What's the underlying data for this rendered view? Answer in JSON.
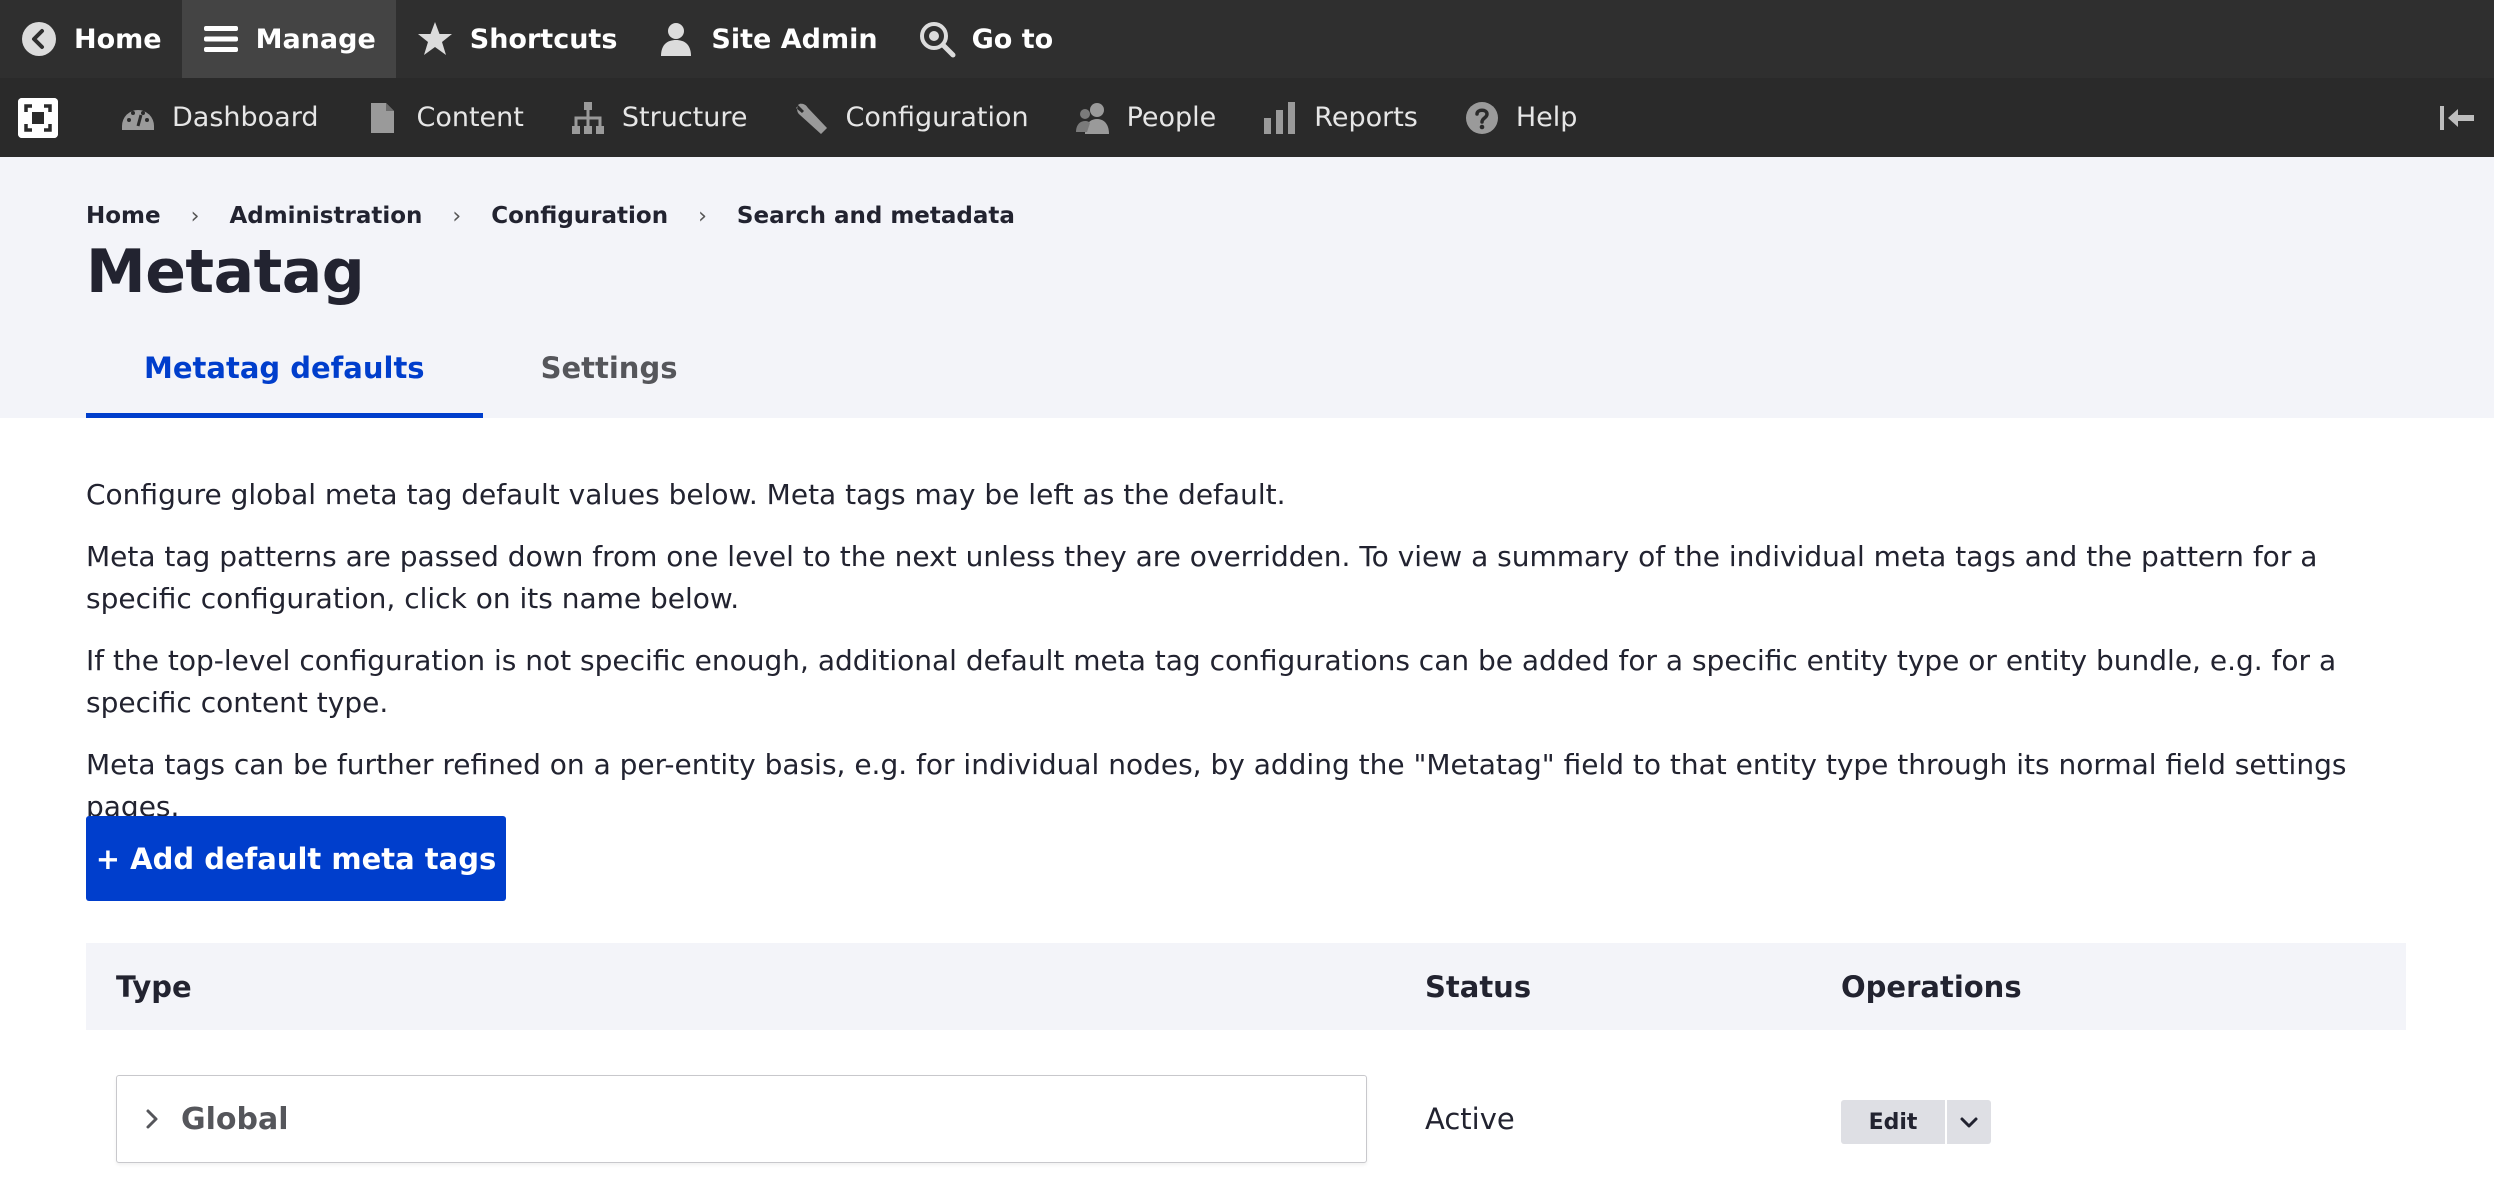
{
  "toolbar": {
    "items": [
      {
        "label": "Home",
        "icon": "back-circle-icon"
      },
      {
        "label": "Manage",
        "icon": "hamburger-menu-icon"
      },
      {
        "label": "Shortcuts",
        "icon": "star-icon"
      },
      {
        "label": "Site Admin",
        "icon": "user-icon"
      },
      {
        "label": "Go to",
        "icon": "search-globe-icon"
      }
    ]
  },
  "tray": {
    "items": [
      {
        "label": "Dashboard",
        "icon": "dashboard-gauge-icon"
      },
      {
        "label": "Content",
        "icon": "document-icon"
      },
      {
        "label": "Structure",
        "icon": "structure-hierarchy-icon"
      },
      {
        "label": "Configuration",
        "icon": "wrench-icon"
      },
      {
        "label": "People",
        "icon": "people-icon"
      },
      {
        "label": "Reports",
        "icon": "bar-chart-icon"
      },
      {
        "label": "Help",
        "icon": "help-icon"
      }
    ]
  },
  "breadcrumb": [
    "Home",
    "Administration",
    "Configuration",
    "Search and metadata"
  ],
  "page_title": "Metatag",
  "tabs": [
    {
      "label": "Metatag defaults",
      "active": true
    },
    {
      "label": "Settings",
      "active": false
    }
  ],
  "description": [
    "Configure global meta tag default values below. Meta tags may be left as the default.",
    "Meta tag patterns are passed down from one level to the next unless they are overridden. To view a summary of the individual meta tags and the pattern for a specific configuration, click on its name below.",
    "If the top-level configuration is not specific enough, additional default meta tag configurations can be added for a specific entity type or entity bundle, e.g. for a specific content type.",
    "Meta tags can be further refined on a per-entity basis, e.g. for individual nodes, by adding the \"Metatag\" field to that entity type through its normal field settings pages."
  ],
  "add_button_label": "+ Add default meta tags",
  "table": {
    "headers": {
      "type": "Type",
      "status": "Status",
      "operations": "Operations"
    },
    "rows": [
      {
        "type": "Global",
        "status": "Active",
        "operation": "Edit"
      }
    ]
  },
  "colors": {
    "accent": "#003ecc",
    "toolbar_bg": "#2f2f2f",
    "header_bg": "#f3f4f9"
  }
}
